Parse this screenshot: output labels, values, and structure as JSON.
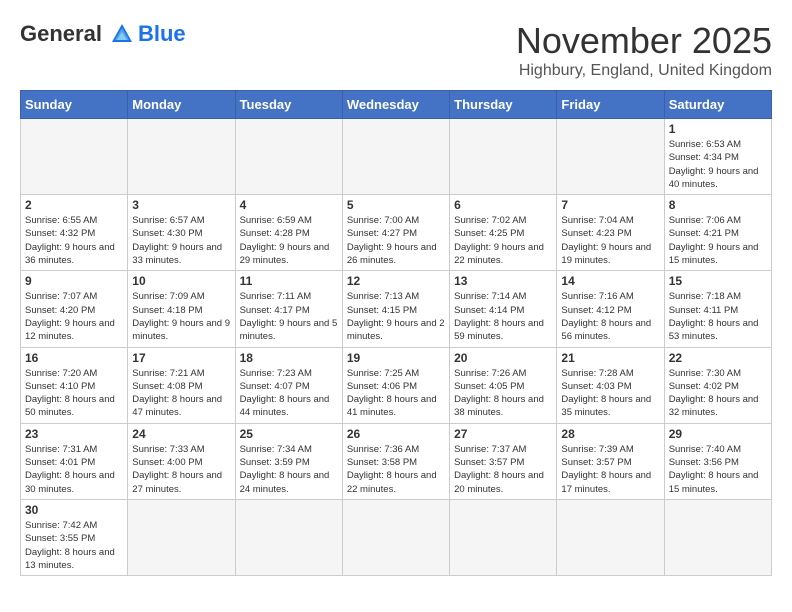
{
  "header": {
    "logo_general": "General",
    "logo_blue": "Blue",
    "month_title": "November 2025",
    "location": "Highbury, England, United Kingdom"
  },
  "days_of_week": [
    "Sunday",
    "Monday",
    "Tuesday",
    "Wednesday",
    "Thursday",
    "Friday",
    "Saturday"
  ],
  "weeks": [
    [
      {
        "day": "",
        "info": ""
      },
      {
        "day": "",
        "info": ""
      },
      {
        "day": "",
        "info": ""
      },
      {
        "day": "",
        "info": ""
      },
      {
        "day": "",
        "info": ""
      },
      {
        "day": "",
        "info": ""
      },
      {
        "day": "1",
        "info": "Sunrise: 6:53 AM\nSunset: 4:34 PM\nDaylight: 9 hours and 40 minutes."
      }
    ],
    [
      {
        "day": "2",
        "info": "Sunrise: 6:55 AM\nSunset: 4:32 PM\nDaylight: 9 hours and 36 minutes."
      },
      {
        "day": "3",
        "info": "Sunrise: 6:57 AM\nSunset: 4:30 PM\nDaylight: 9 hours and 33 minutes."
      },
      {
        "day": "4",
        "info": "Sunrise: 6:59 AM\nSunset: 4:28 PM\nDaylight: 9 hours and 29 minutes."
      },
      {
        "day": "5",
        "info": "Sunrise: 7:00 AM\nSunset: 4:27 PM\nDaylight: 9 hours and 26 minutes."
      },
      {
        "day": "6",
        "info": "Sunrise: 7:02 AM\nSunset: 4:25 PM\nDaylight: 9 hours and 22 minutes."
      },
      {
        "day": "7",
        "info": "Sunrise: 7:04 AM\nSunset: 4:23 PM\nDaylight: 9 hours and 19 minutes."
      },
      {
        "day": "8",
        "info": "Sunrise: 7:06 AM\nSunset: 4:21 PM\nDaylight: 9 hours and 15 minutes."
      }
    ],
    [
      {
        "day": "9",
        "info": "Sunrise: 7:07 AM\nSunset: 4:20 PM\nDaylight: 9 hours and 12 minutes."
      },
      {
        "day": "10",
        "info": "Sunrise: 7:09 AM\nSunset: 4:18 PM\nDaylight: 9 hours and 9 minutes."
      },
      {
        "day": "11",
        "info": "Sunrise: 7:11 AM\nSunset: 4:17 PM\nDaylight: 9 hours and 5 minutes."
      },
      {
        "day": "12",
        "info": "Sunrise: 7:13 AM\nSunset: 4:15 PM\nDaylight: 9 hours and 2 minutes."
      },
      {
        "day": "13",
        "info": "Sunrise: 7:14 AM\nSunset: 4:14 PM\nDaylight: 8 hours and 59 minutes."
      },
      {
        "day": "14",
        "info": "Sunrise: 7:16 AM\nSunset: 4:12 PM\nDaylight: 8 hours and 56 minutes."
      },
      {
        "day": "15",
        "info": "Sunrise: 7:18 AM\nSunset: 4:11 PM\nDaylight: 8 hours and 53 minutes."
      }
    ],
    [
      {
        "day": "16",
        "info": "Sunrise: 7:20 AM\nSunset: 4:10 PM\nDaylight: 8 hours and 50 minutes."
      },
      {
        "day": "17",
        "info": "Sunrise: 7:21 AM\nSunset: 4:08 PM\nDaylight: 8 hours and 47 minutes."
      },
      {
        "day": "18",
        "info": "Sunrise: 7:23 AM\nSunset: 4:07 PM\nDaylight: 8 hours and 44 minutes."
      },
      {
        "day": "19",
        "info": "Sunrise: 7:25 AM\nSunset: 4:06 PM\nDaylight: 8 hours and 41 minutes."
      },
      {
        "day": "20",
        "info": "Sunrise: 7:26 AM\nSunset: 4:05 PM\nDaylight: 8 hours and 38 minutes."
      },
      {
        "day": "21",
        "info": "Sunrise: 7:28 AM\nSunset: 4:03 PM\nDaylight: 8 hours and 35 minutes."
      },
      {
        "day": "22",
        "info": "Sunrise: 7:30 AM\nSunset: 4:02 PM\nDaylight: 8 hours and 32 minutes."
      }
    ],
    [
      {
        "day": "23",
        "info": "Sunrise: 7:31 AM\nSunset: 4:01 PM\nDaylight: 8 hours and 30 minutes."
      },
      {
        "day": "24",
        "info": "Sunrise: 7:33 AM\nSunset: 4:00 PM\nDaylight: 8 hours and 27 minutes."
      },
      {
        "day": "25",
        "info": "Sunrise: 7:34 AM\nSunset: 3:59 PM\nDaylight: 8 hours and 24 minutes."
      },
      {
        "day": "26",
        "info": "Sunrise: 7:36 AM\nSunset: 3:58 PM\nDaylight: 8 hours and 22 minutes."
      },
      {
        "day": "27",
        "info": "Sunrise: 7:37 AM\nSunset: 3:57 PM\nDaylight: 8 hours and 20 minutes."
      },
      {
        "day": "28",
        "info": "Sunrise: 7:39 AM\nSunset: 3:57 PM\nDaylight: 8 hours and 17 minutes."
      },
      {
        "day": "29",
        "info": "Sunrise: 7:40 AM\nSunset: 3:56 PM\nDaylight: 8 hours and 15 minutes."
      }
    ],
    [
      {
        "day": "30",
        "info": "Sunrise: 7:42 AM\nSunset: 3:55 PM\nDaylight: 8 hours and 13 minutes."
      },
      {
        "day": "",
        "info": ""
      },
      {
        "day": "",
        "info": ""
      },
      {
        "day": "",
        "info": ""
      },
      {
        "day": "",
        "info": ""
      },
      {
        "day": "",
        "info": ""
      },
      {
        "day": "",
        "info": ""
      }
    ]
  ]
}
